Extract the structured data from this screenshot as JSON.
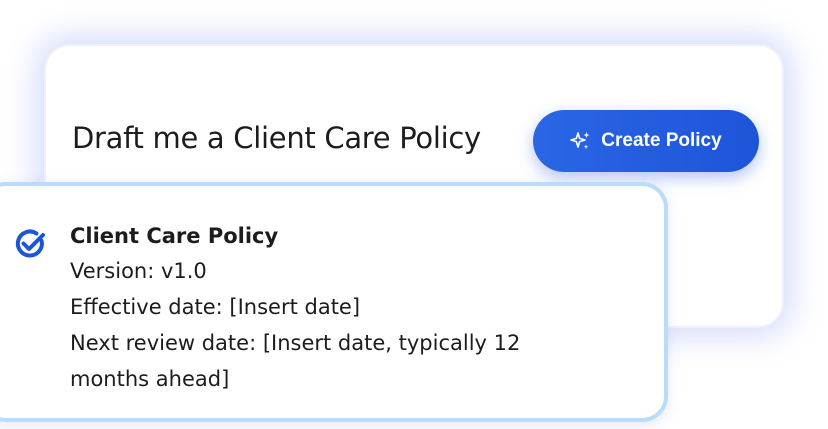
{
  "prompt": {
    "text": "Draft me a Client Care Policy",
    "button_label": "Create Policy",
    "button_icon": "sparkle-icon"
  },
  "result": {
    "icon": "check-circle-icon",
    "title": "Client Care Policy",
    "version_line": "Version: v1.0",
    "effective_line": "Effective date: [Insert date]",
    "review_line": "Next review date: [Insert date, typically 12 months ahead]"
  },
  "colors": {
    "accent": "#1d55da",
    "card_border": "#b9dcfb",
    "glow": "#7f8ef0",
    "text": "#1c1c1c"
  }
}
